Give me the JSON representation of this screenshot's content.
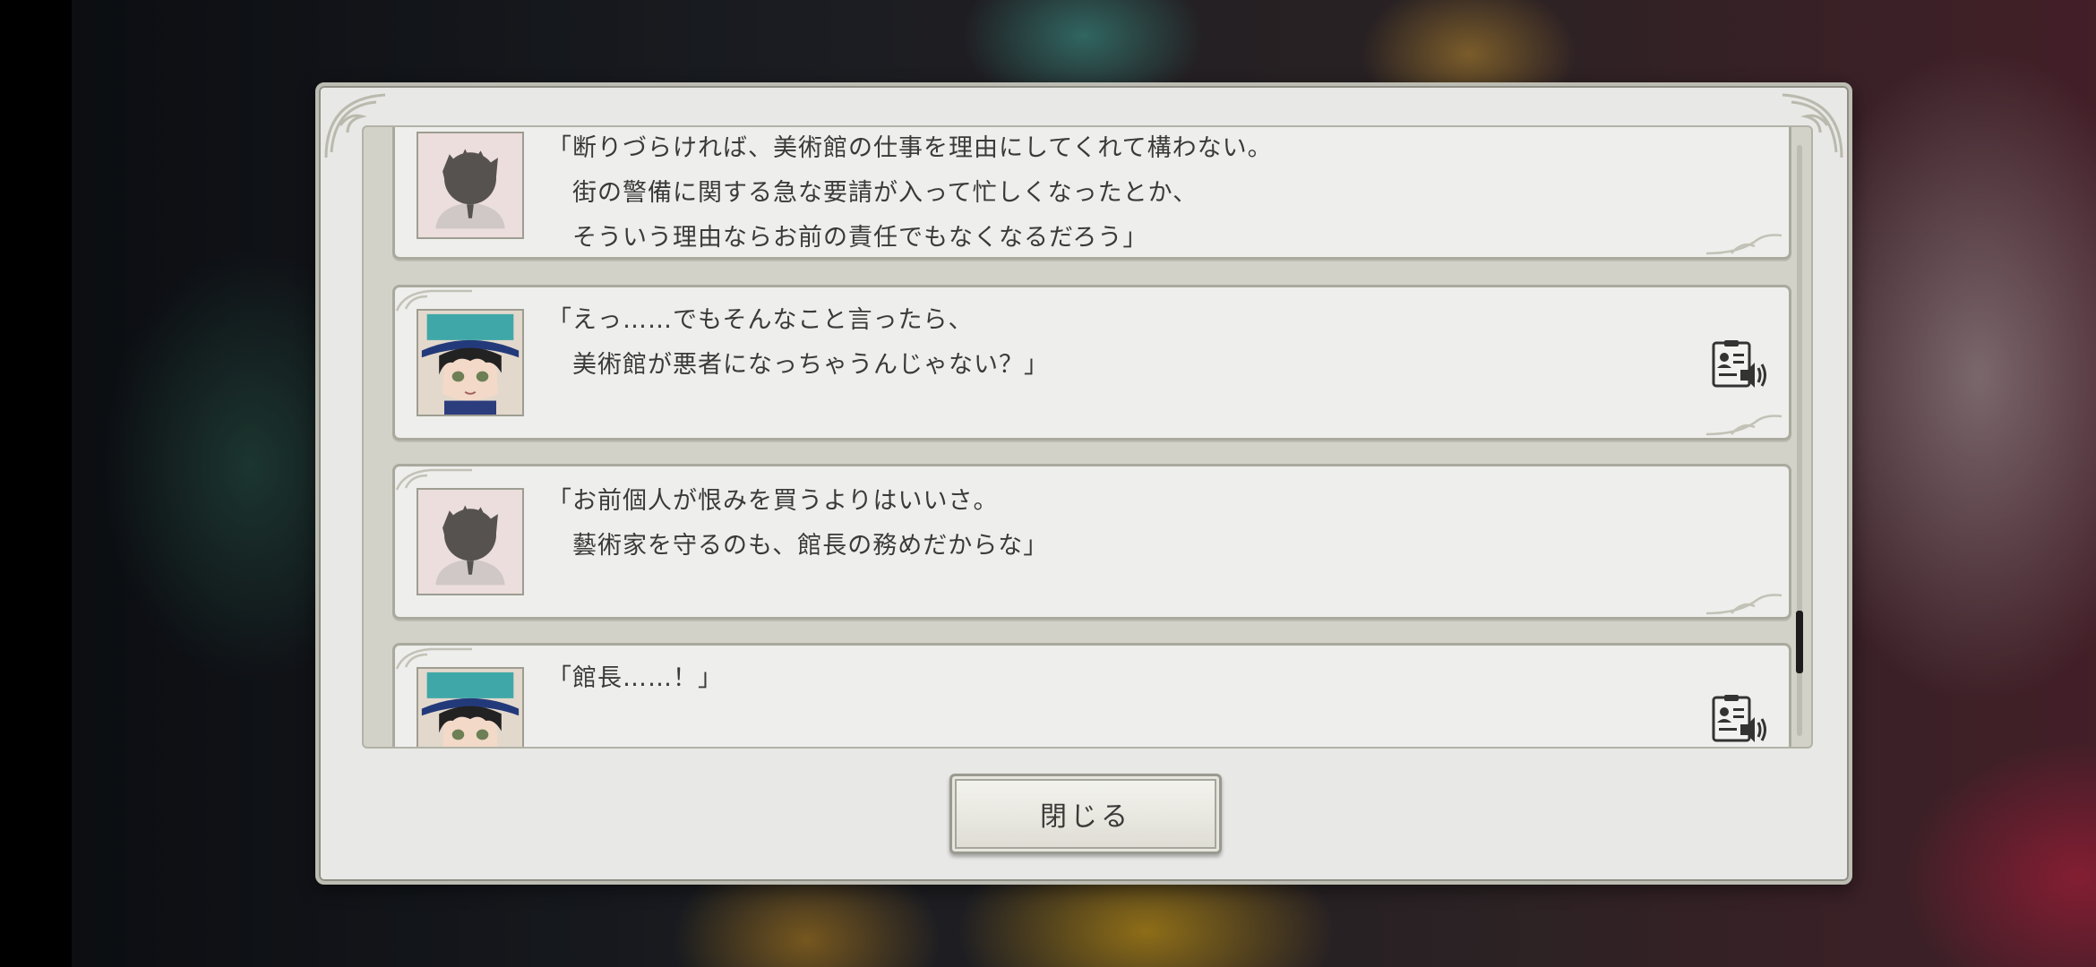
{
  "log": {
    "entries": [
      {
        "speaker_type": "silhouette",
        "lines": [
          "「断りづらければ、美術館の仕事を理由にしてくれて構わない。",
          "　街の警備に関する急な要請が入って忙しくなったとか、",
          "　そういう理由ならお前の責任でもなくなるだろう」"
        ],
        "has_voice": false
      },
      {
        "speaker_type": "character",
        "lines": [
          "「えっ……でもそんなこと言ったら、",
          "　美術館が悪者になっちゃうんじゃない？」"
        ],
        "has_voice": true
      },
      {
        "speaker_type": "silhouette",
        "lines": [
          "「お前個人が恨みを買うよりはいいさ。",
          "　藝術家を守るのも、館長の務めだからな」"
        ],
        "has_voice": false
      },
      {
        "speaker_type": "character",
        "lines": [
          "「館長……！」"
        ],
        "has_voice": true
      }
    ]
  },
  "close_button": {
    "label": "閉じる"
  },
  "icons": {
    "voice": "voice-replay-icon",
    "portrait_silhouette": "unknown-speaker-silhouette-icon"
  },
  "colors": {
    "panel": "#e8e8e6",
    "entry_bg": "#eeeeec",
    "text": "#3a3a38",
    "scroll_thumb": "#1c1c1c"
  }
}
